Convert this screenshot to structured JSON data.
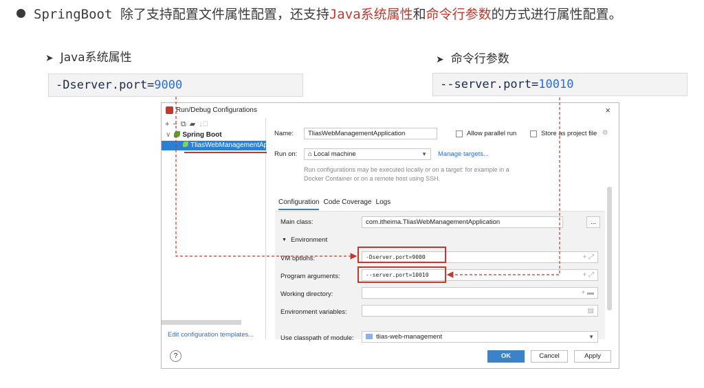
{
  "slide": {
    "heading_pre": "SpringBoot 除了支持配置文件属性配置，还支持",
    "heading_hl1": "Java系统属性",
    "heading_mid": "和",
    "heading_hl2": "命令行参数",
    "heading_post": "的方式进行属性配置。",
    "left_title": "Java系统属性",
    "left_code_prefix": "-Dserver.port=",
    "left_code_value": "9000",
    "right_title": "命令行参数",
    "right_code_prefix": "--server.port=",
    "right_code_value": "10010",
    "accent_color": "#c0392b"
  },
  "dialog": {
    "title": "Run/Debug Configurations",
    "close": "×",
    "toolbar": [
      "+",
      "−",
      "⧉",
      "▰",
      "↓⃒"
    ],
    "tree": {
      "group": "Spring Boot",
      "selected_item": "TliasWebManagementApplication"
    },
    "edit_templates": "Edit configuration templates...",
    "name_label": "Name:",
    "name_value": "TliasWebManagementApplication",
    "allow_parallel": "Allow parallel run",
    "store_project": "Store as project file",
    "run_on_label": "Run on:",
    "run_on_value": "Local machine",
    "manage_targets": "Manage targets...",
    "run_hint": "Run configurations may be executed locally or on a target: for example in a Docker Container or on a remote host using SSH.",
    "tabs": [
      "Configuration",
      "Code Coverage",
      "Logs"
    ],
    "main_class_label": "Main class:",
    "main_class_value": "com.itheima.TliasWebManagementApplication",
    "ellipsis": "...",
    "environment_label": "Environment",
    "vm_options_label": "VM options:",
    "vm_options_value": "-Dserver.port=9000",
    "program_args_label": "Program arguments:",
    "program_args_value": "--server.port=10010",
    "working_dir_label": "Working directory:",
    "env_vars_label": "Environment variables:",
    "classpath_label": "Use classpath of module:",
    "classpath_value": "tlias-web-management",
    "help": "?",
    "ok": "OK",
    "cancel": "Cancel",
    "apply": "Apply"
  }
}
